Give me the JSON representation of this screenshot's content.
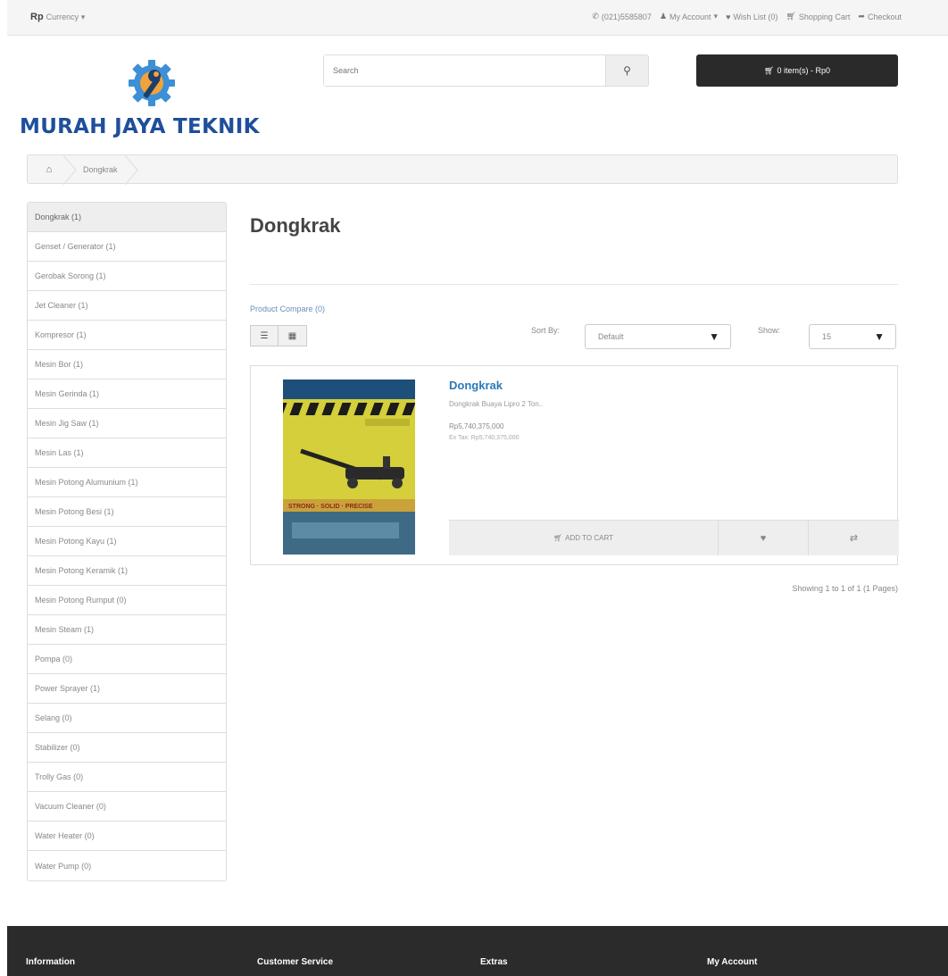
{
  "topbar": {
    "currency_symbol": "Rp",
    "currency_label": "Currency",
    "phone": "(021)5585807",
    "my_account": "My Account",
    "wish_list": "Wish List (0)",
    "shopping_cart": "Shopping Cart",
    "checkout": "Checkout"
  },
  "header": {
    "brand": "MURAH JAYA TEKNIK",
    "search_placeholder": "Search",
    "cart_summary": "0 item(s) - Rp0"
  },
  "breadcrumb": {
    "current": "Dongkrak"
  },
  "sidebar": {
    "items": [
      {
        "label": "Dongkrak (1)"
      },
      {
        "label": "Genset / Generator (1)"
      },
      {
        "label": "Gerobak Sorong (1)"
      },
      {
        "label": "Jet Cleaner (1)"
      },
      {
        "label": "Kompresor (1)"
      },
      {
        "label": "Mesin Bor (1)"
      },
      {
        "label": "Mesin Gerinda (1)"
      },
      {
        "label": "Mesin Jig Saw (1)"
      },
      {
        "label": "Mesin Las (1)"
      },
      {
        "label": "Mesin Potong Alumunium (1)"
      },
      {
        "label": "Mesin Potong Besi (1)"
      },
      {
        "label": "Mesin Potong Kayu (1)"
      },
      {
        "label": "Mesin Potong Keramik (1)"
      },
      {
        "label": "Mesin Potong Rumput (0)"
      },
      {
        "label": "Mesin Steam (1)"
      },
      {
        "label": "Pompa (0)"
      },
      {
        "label": "Power Sprayer (1)"
      },
      {
        "label": "Selang (0)"
      },
      {
        "label": "Stabilizer (0)"
      },
      {
        "label": "Trolly Gas (0)"
      },
      {
        "label": "Vacuum Cleaner (0)"
      },
      {
        "label": "Water Heater (0)"
      },
      {
        "label": "Water Pump (0)"
      }
    ]
  },
  "main": {
    "title": "Dongkrak",
    "product_compare": "Product Compare (0)",
    "sort_label": "Sort By:",
    "sort_value": "Default",
    "show_label": "Show:",
    "show_value": "15",
    "showing": "Showing 1 to 1 of 1 (1 Pages)"
  },
  "product": {
    "name": "Dongkrak",
    "description": "Dongkrak Buaya Lipro 2 Ton..",
    "price": "Rp5,740,375,000",
    "ex_tax": "Ex Tax: Rp5,740,375,000",
    "add_to_cart": "ADD TO CART",
    "image_text": "STRONG · SOLID · PRECISE"
  },
  "footer": {
    "headings": [
      "Information",
      "Customer Service",
      "Extras",
      "My Account"
    ]
  },
  "colors": {
    "brand_blue": "#1f4f9c",
    "link_blue": "#2a7ab8",
    "cart_bg": "#2a2a2a",
    "footer_bg": "#2b2b2b"
  }
}
